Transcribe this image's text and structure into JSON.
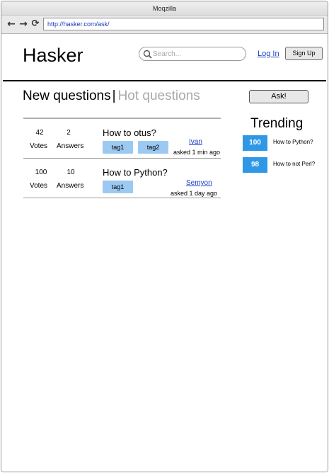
{
  "browser": {
    "title": "Moqzilla",
    "url": "http://hasker.com/ask/",
    "back_icon": "←",
    "forward_icon": "→",
    "reload_icon": "⟳"
  },
  "header": {
    "logo": "Hasker",
    "search_placeholder": "Search...",
    "login_label": "Log In",
    "signup_label": "Sign Up"
  },
  "tabs": {
    "new_label": "New questions",
    "separator": "|",
    "hot_label": "Hot questions"
  },
  "ask_label": "Ask!",
  "questions": [
    {
      "votes": "42",
      "votes_label": "Votes",
      "answers": "2",
      "answers_label": "Answers",
      "title": "How to otus?",
      "tags": [
        "tag1",
        "tag2"
      ],
      "author": "Ivan",
      "asked": "asked 1 min ago"
    },
    {
      "votes": "100",
      "votes_label": "Votes",
      "answers": "10",
      "answers_label": "Answers",
      "title": "How to Python?",
      "tags": [
        "tag1"
      ],
      "author": "Semyon",
      "asked": "asked 1 day ago"
    }
  ],
  "trending": {
    "title": "Trending",
    "items": [
      {
        "score": "100",
        "title": "How to Python?"
      },
      {
        "score": "98",
        "title": "How to not Perl?"
      }
    ]
  },
  "colors": {
    "accent": "#2f98e6",
    "tag": "#9cc9f2",
    "link": "#1a3fc4",
    "muted_tab": "#a9a9a9"
  }
}
